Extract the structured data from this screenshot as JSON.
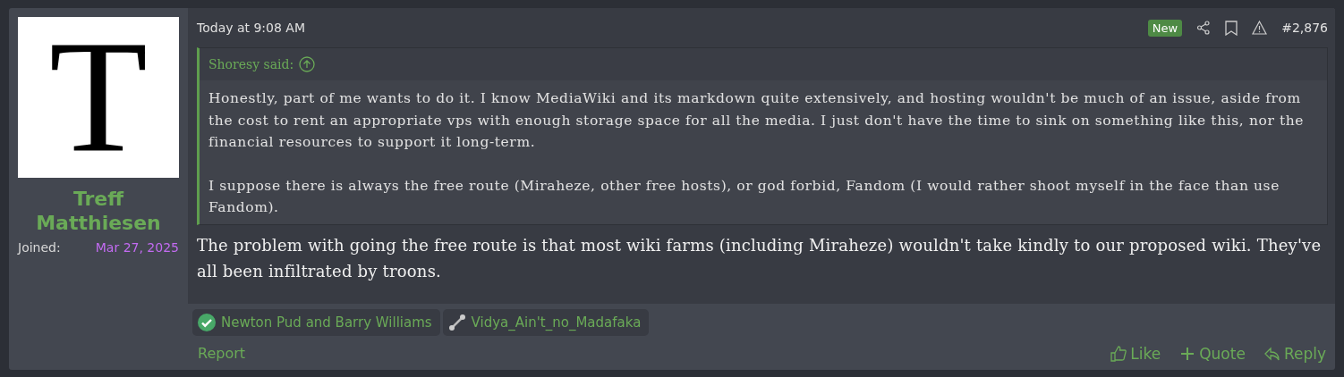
{
  "author": {
    "avatar_letter": "T",
    "name": "Treff Matthiesen",
    "joined_label": "Joined:",
    "joined_date": "Mar 27, 2025"
  },
  "post": {
    "time": "Today at 9:08 AM",
    "badge": "New",
    "number": "#2,876",
    "quote": {
      "author": "Shoresy said:",
      "paragraphs": [
        "Honestly, part of me wants to do it. I know MediaWiki and its markdown quite extensively, and hosting wouldn't be much of an issue, aside from the cost to rent an appropriate vps with enough storage space for all the media. I just don't have the time to sink on something like this, nor the financial resources to support it long-term.",
        "I suppose there is always the free route (Miraheze, other free hosts), or god forbid, Fandom (I would rather shoot myself in the face than use Fandom)."
      ]
    },
    "body": "The problem with going the free route is that most wiki farms (including Miraheze) wouldn't take kindly to our proposed wiki. They've all been infiltrated by troons."
  },
  "reactions": [
    {
      "kind": "check",
      "label": "Newton Pud and Barry Williams"
    },
    {
      "kind": "bone",
      "label": "Vidya_Ain't_no_Madafaka"
    }
  ],
  "footer": {
    "report": "Report",
    "actions": [
      {
        "kind": "like",
        "label": "Like"
      },
      {
        "kind": "quote",
        "label": "Quote"
      },
      {
        "kind": "reply",
        "label": "Reply"
      }
    ]
  }
}
